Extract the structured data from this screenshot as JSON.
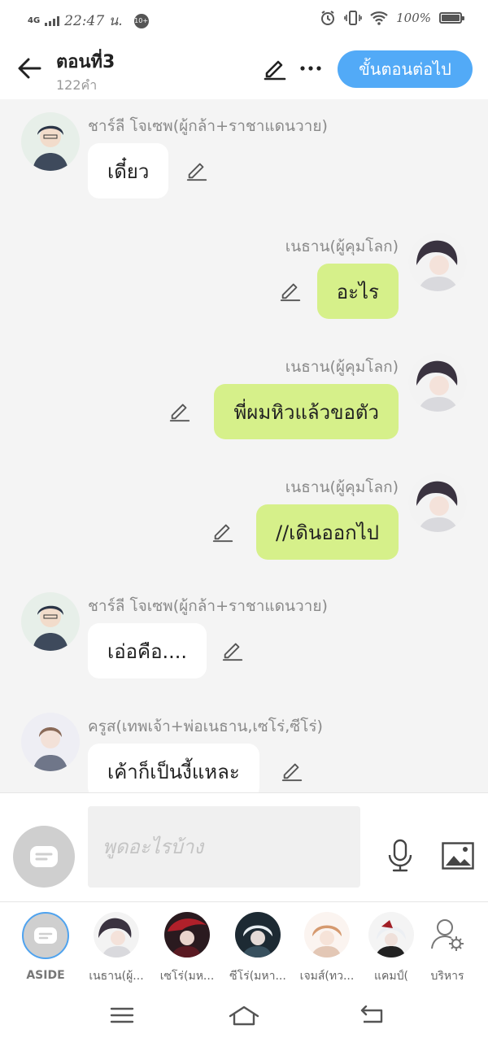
{
  "status_bar": {
    "network": "4G",
    "time": "22:47 น.",
    "notification_badge": "10+",
    "battery_percent": "100%",
    "battery_level": 1.0
  },
  "header": {
    "title": "ตอนที่3",
    "word_count": "122คำ",
    "next_button": "ขั้นตอนต่อไป",
    "more_label": "···"
  },
  "messages": [
    {
      "side": "left",
      "name": "ชาร์ลี โจเซพ(ผู้กล้า+ราชาแดนวาย)",
      "text": "เดี๋ยว",
      "color": "white",
      "avatar": "charlie-avatar"
    },
    {
      "side": "right",
      "name": "เนธาน(ผู้คุมโลก)",
      "text": "อะไร",
      "color": "green",
      "avatar": "nethan-avatar"
    },
    {
      "side": "right",
      "name": "เนธาน(ผู้คุมโลก)",
      "text": "พี่ผมหิวแล้วขอตัว",
      "color": "green",
      "avatar": "nethan-avatar"
    },
    {
      "side": "right",
      "name": "เนธาน(ผู้คุมโลก)",
      "text": "//เดินออกไป",
      "color": "green",
      "avatar": "nethan-avatar"
    },
    {
      "side": "left",
      "name": "ชาร์ลี โจเซพ(ผู้กล้า+ราชาแดนวาย)",
      "text": "เอ่อคือ....",
      "color": "white",
      "avatar": "charlie-avatar"
    },
    {
      "side": "left",
      "name": "ครูส(เทพเจ้า+พ่อเนธาน,เซโร่,ซีโร่)",
      "text": "เค้าก็เป็นงี้แหละ",
      "color": "white",
      "avatar": "cruz-avatar"
    }
  ],
  "input": {
    "placeholder": "พูดอะไรบ้าง"
  },
  "characters": [
    {
      "label": "ASIDE"
    },
    {
      "label": "เนธาน(ผู้..."
    },
    {
      "label": "เซโร่(มห..."
    },
    {
      "label": "ซีโร่(มหา..."
    },
    {
      "label": "เจมส์(ทว..."
    },
    {
      "label": "แคมป์("
    },
    {
      "label": "บริหาร"
    }
  ],
  "colors": {
    "accent": "#52aaf7",
    "bubble_self": "#d6f08a",
    "bubble_other": "#ffffff",
    "chat_background": "#f4f4f4"
  }
}
